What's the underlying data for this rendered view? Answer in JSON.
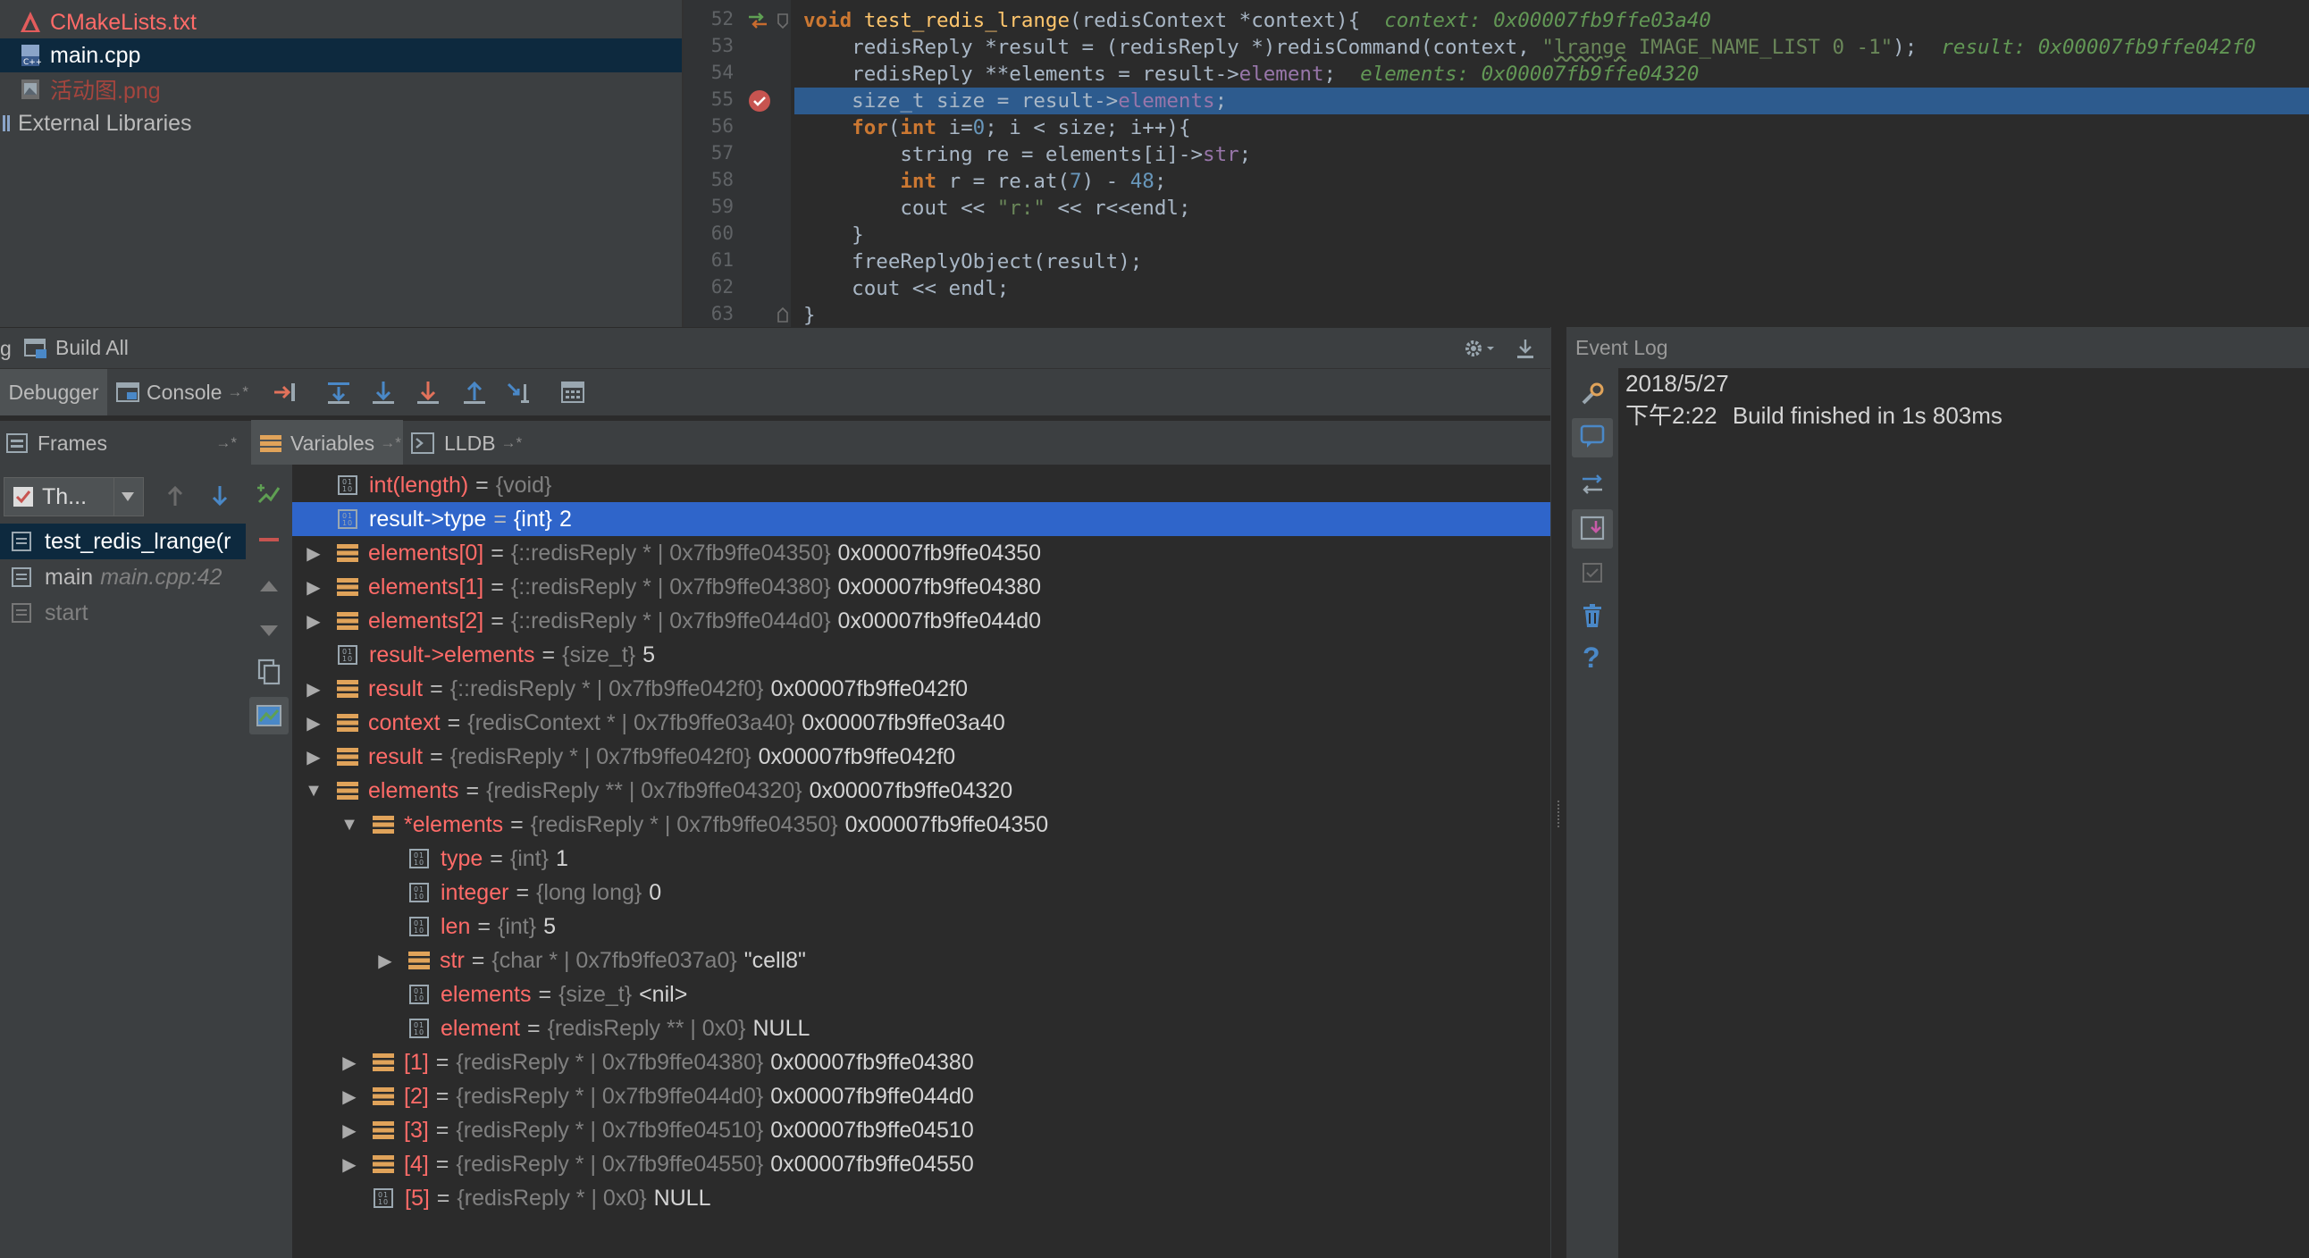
{
  "project_tree": {
    "items": [
      {
        "label": "CMakeLists.txt",
        "icon": "cmake-icon",
        "color": "#ff6b68"
      },
      {
        "label": "main.cpp",
        "icon": "cpp-file-icon",
        "color": "#bbbbbb"
      },
      {
        "label": "活动图.png",
        "icon": "image-file-icon",
        "color": "#a5453e"
      },
      {
        "label": "External Libraries",
        "icon": "library-icon",
        "color": "#bbbbbb"
      }
    ]
  },
  "editor": {
    "line_numbers": [
      "52",
      "53",
      "54",
      "55",
      "56",
      "57",
      "58",
      "59",
      "60",
      "61",
      "62",
      "63"
    ],
    "inline_values": {
      "context": "context: 0x00007fb9ffe03a40",
      "result": "result: 0x00007fb9ffe042f0",
      "elements": "elements: 0x00007fb9ffe04320"
    },
    "current_line": "55"
  },
  "toolbar": {
    "build_all": "Build All",
    "debugger_tab": "Debugger",
    "console_tab": "Console",
    "frames_tab": "Frames",
    "variables_tab": "Variables",
    "lldb_tab": "LLDB",
    "thread_label": "Th..."
  },
  "frames": [
    {
      "name": "test_redis_lrange(r",
      "location": ""
    },
    {
      "name": "main",
      "location": "main.cpp:42"
    },
    {
      "name": "start",
      "location": ""
    }
  ],
  "variables": [
    {
      "depth": 0,
      "arrow": "",
      "kind": "prim",
      "name": "int(length)",
      "type": "{void}",
      "value": ""
    },
    {
      "depth": 0,
      "arrow": "",
      "kind": "prim",
      "name": "result->type",
      "type": "{int}",
      "value": "2",
      "selected": true
    },
    {
      "depth": 0,
      "arrow": "▶",
      "kind": "struct",
      "name": "elements[0]",
      "type": "{::redisReply * | 0x7fb9ffe04350}",
      "value": "0x00007fb9ffe04350"
    },
    {
      "depth": 0,
      "arrow": "▶",
      "kind": "struct",
      "name": "elements[1]",
      "type": "{::redisReply * | 0x7fb9ffe04380}",
      "value": "0x00007fb9ffe04380"
    },
    {
      "depth": 0,
      "arrow": "▶",
      "kind": "struct",
      "name": "elements[2]",
      "type": "{::redisReply * | 0x7fb9ffe044d0}",
      "value": "0x00007fb9ffe044d0"
    },
    {
      "depth": 0,
      "arrow": "",
      "kind": "prim",
      "name": "result->elements",
      "type": "{size_t}",
      "value": "5"
    },
    {
      "depth": 0,
      "arrow": "▶",
      "kind": "struct",
      "name": "result",
      "type": "{::redisReply * | 0x7fb9ffe042f0}",
      "value": "0x00007fb9ffe042f0"
    },
    {
      "depth": 0,
      "arrow": "▶",
      "kind": "struct",
      "name": "context",
      "type": "{redisContext * | 0x7fb9ffe03a40}",
      "value": "0x00007fb9ffe03a40"
    },
    {
      "depth": 0,
      "arrow": "▶",
      "kind": "struct",
      "name": "result",
      "type": "{redisReply * | 0x7fb9ffe042f0}",
      "value": "0x00007fb9ffe042f0"
    },
    {
      "depth": 0,
      "arrow": "▼",
      "kind": "struct",
      "name": "elements",
      "type": "{redisReply ** | 0x7fb9ffe04320}",
      "value": "0x00007fb9ffe04320"
    },
    {
      "depth": 1,
      "arrow": "▼",
      "kind": "struct",
      "name": "*elements",
      "type": "{redisReply * | 0x7fb9ffe04350}",
      "value": "0x00007fb9ffe04350"
    },
    {
      "depth": 2,
      "arrow": "",
      "kind": "prim",
      "name": "type",
      "type": "{int}",
      "value": "1"
    },
    {
      "depth": 2,
      "arrow": "",
      "kind": "prim",
      "name": "integer",
      "type": "{long long}",
      "value": "0"
    },
    {
      "depth": 2,
      "arrow": "",
      "kind": "prim",
      "name": "len",
      "type": "{int}",
      "value": "5"
    },
    {
      "depth": 2,
      "arrow": "▶",
      "kind": "struct",
      "name": "str",
      "type": "{char * | 0x7fb9ffe037a0}",
      "value": "\"cell8\""
    },
    {
      "depth": 2,
      "arrow": "",
      "kind": "prim",
      "name": "elements",
      "type": "{size_t}",
      "value": "<nil>"
    },
    {
      "depth": 2,
      "arrow": "",
      "kind": "prim",
      "name": "element",
      "type": "{redisReply ** | 0x0}",
      "value": "NULL"
    },
    {
      "depth": 1,
      "arrow": "▶",
      "kind": "struct",
      "name": "[1]",
      "type": "{redisReply * | 0x7fb9ffe04380}",
      "value": "0x00007fb9ffe04380"
    },
    {
      "depth": 1,
      "arrow": "▶",
      "kind": "struct",
      "name": "[2]",
      "type": "{redisReply * | 0x7fb9ffe044d0}",
      "value": "0x00007fb9ffe044d0"
    },
    {
      "depth": 1,
      "arrow": "▶",
      "kind": "struct",
      "name": "[3]",
      "type": "{redisReply * | 0x7fb9ffe04510}",
      "value": "0x00007fb9ffe04510"
    },
    {
      "depth": 1,
      "arrow": "▶",
      "kind": "struct",
      "name": "[4]",
      "type": "{redisReply * | 0x7fb9ffe04550}",
      "value": "0x00007fb9ffe04550"
    },
    {
      "depth": 1,
      "arrow": "",
      "kind": "prim",
      "name": "[5]",
      "type": "{redisReply * | 0x0}",
      "value": "NULL"
    }
  ],
  "event_log": {
    "title": "Event Log",
    "date": "2018/5/27",
    "time": "下午2:22",
    "message": "Build finished in 1s 803ms"
  },
  "colors": {
    "selection": "#2f65ca",
    "variable_name": "#ff6b68",
    "breakpoint": "#c75450",
    "current_line": "#2d5b8e"
  }
}
